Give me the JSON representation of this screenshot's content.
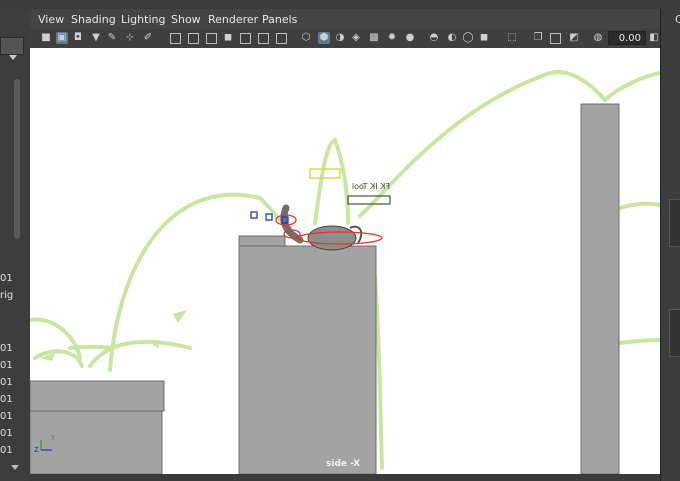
{
  "menu": {
    "items": [
      "View",
      "Shading",
      "Lighting",
      "Show",
      "Renderer",
      "Panels"
    ]
  },
  "toolbar": {
    "exposure_value": "0.00"
  },
  "left_panel": {
    "channel_values": [
      "01",
      "rig",
      "01",
      "01",
      "01",
      "01",
      "01",
      "01",
      "01"
    ]
  },
  "right_panel": {
    "tab_label": "C"
  },
  "viewport": {
    "camera_label": "side -X",
    "axis_z_label": "Z",
    "axis_y_label": "Y",
    "control_text": "FK IK Tool"
  },
  "colors": {
    "background": "#ffffff",
    "pillar": "#a3a3a3",
    "motion_trail": "#c8e6a0",
    "control_red": "#d83a2a",
    "control_blue": "#2233cc",
    "selection_highlight": "#5e7a93"
  }
}
